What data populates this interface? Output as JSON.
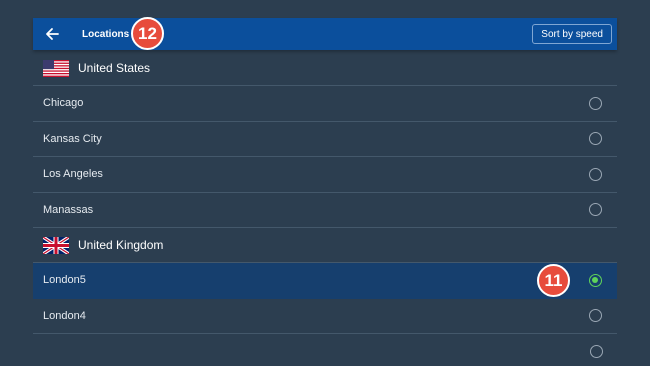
{
  "header": {
    "back_icon": "arrow-left-icon",
    "title": "Locations",
    "sort_label": "Sort by speed",
    "background_color": "#0b4f9c"
  },
  "annotations": {
    "badge_top": "12",
    "badge_selected": "11",
    "badge_color": "#e74c3c"
  },
  "groups": [
    {
      "name": "United States",
      "flag": "us-flag-icon",
      "items": [
        {
          "label": "Chicago",
          "selected": false
        },
        {
          "label": "Kansas City",
          "selected": false
        },
        {
          "label": "Los Angeles",
          "selected": false
        },
        {
          "label": "Manassas",
          "selected": false
        }
      ]
    },
    {
      "name": "United Kingdom",
      "flag": "uk-flag-icon",
      "items": [
        {
          "label": "London5",
          "selected": true
        },
        {
          "label": "London4",
          "selected": false
        }
      ]
    }
  ],
  "colors": {
    "background": "#2c3e50",
    "selected_row": "#163f6e",
    "radio_checked": "#5fd35a"
  }
}
